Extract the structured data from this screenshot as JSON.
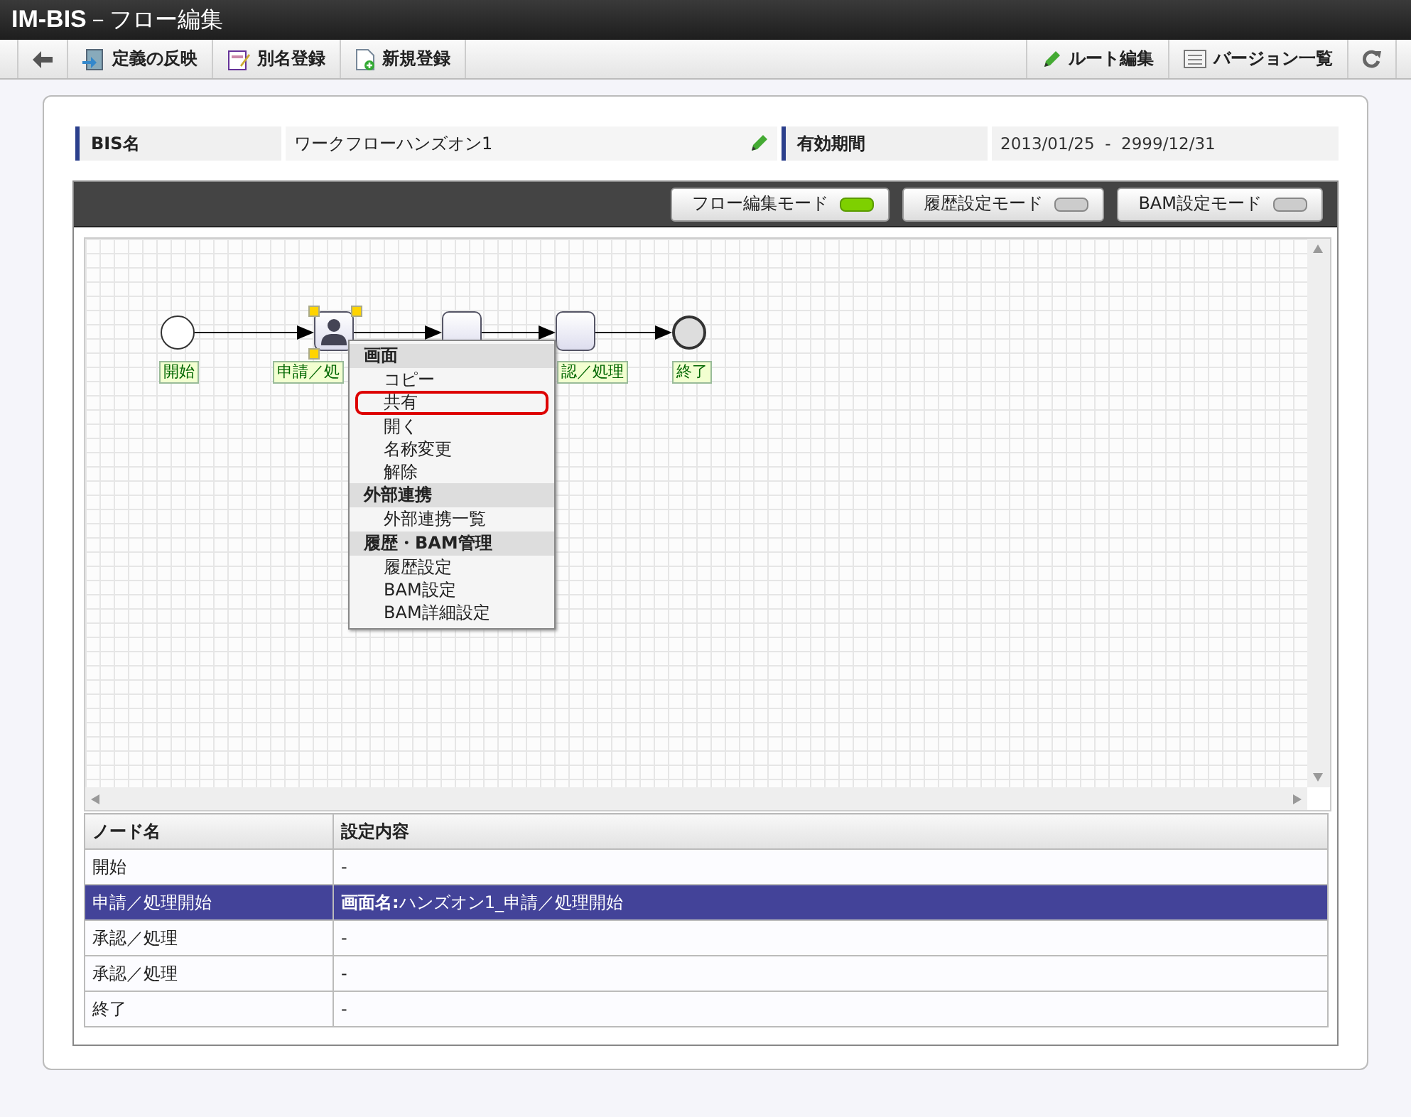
{
  "window": {
    "title_bold": "IM-BIS",
    "title": "－フロー編集"
  },
  "toolbar": {
    "left": [
      {
        "kind": "back"
      },
      {
        "kind": "deploy",
        "label": "定義の反映"
      },
      {
        "kind": "alias",
        "label": "別名登録"
      },
      {
        "kind": "new",
        "label": "新規登録"
      }
    ],
    "right": [
      {
        "kind": "route",
        "label": "ルート編集"
      },
      {
        "kind": "versions",
        "label": "バージョン一覧"
      },
      {
        "kind": "refresh"
      }
    ]
  },
  "info": {
    "name_label": "BIS名",
    "name_value": "ワークフローハンズオン1",
    "period_label": "有効期間",
    "period_value": "2013/01/25  -  2999/12/31"
  },
  "modes": [
    {
      "label": "フロー編集モード",
      "on": true
    },
    {
      "label": "履歴設定モード",
      "on": false
    },
    {
      "label": "BAM設定モード",
      "on": false
    }
  ],
  "nodes": [
    {
      "kind": "start",
      "label": "開始",
      "selected": false
    },
    {
      "kind": "user_task",
      "label": "申請／処",
      "selected": true
    },
    {
      "kind": "task",
      "selected": false
    },
    {
      "kind": "task",
      "label": "認／処理",
      "selected": false
    },
    {
      "kind": "end",
      "label": "終了",
      "selected": false
    }
  ],
  "context_menu": [
    {
      "kind": "header",
      "label": "画面"
    },
    {
      "kind": "item",
      "label": "コピー",
      "highlighted": false
    },
    {
      "kind": "item",
      "label": "共有",
      "highlighted": true
    },
    {
      "kind": "item",
      "label": "開く",
      "highlighted": false
    },
    {
      "kind": "item",
      "label": "名称変更",
      "highlighted": false
    },
    {
      "kind": "item",
      "label": "解除",
      "highlighted": false
    },
    {
      "kind": "header",
      "label": "外部連携"
    },
    {
      "kind": "item",
      "label": "外部連携一覧",
      "highlighted": false
    },
    {
      "kind": "header",
      "label": "履歴・BAM管理"
    },
    {
      "kind": "item",
      "label": "履歴設定",
      "highlighted": false
    },
    {
      "kind": "item",
      "label": "BAM設定",
      "highlighted": false
    },
    {
      "kind": "item",
      "label": "BAM詳細設定",
      "highlighted": false
    }
  ],
  "table": {
    "columns": [
      "ノード名",
      "設定内容"
    ],
    "rows": [
      {
        "node": "開始",
        "content": "-",
        "selected": false
      },
      {
        "node": "申請／処理開始",
        "content": "**画面名:**ハンズオン1_申請／処理開始",
        "selected": true
      },
      {
        "node": "承認／処理",
        "content": "-",
        "selected": false
      },
      {
        "node": "承認／処理",
        "content": "-",
        "selected": false
      },
      {
        "node": "終了",
        "content": "-",
        "selected": false
      }
    ]
  }
}
